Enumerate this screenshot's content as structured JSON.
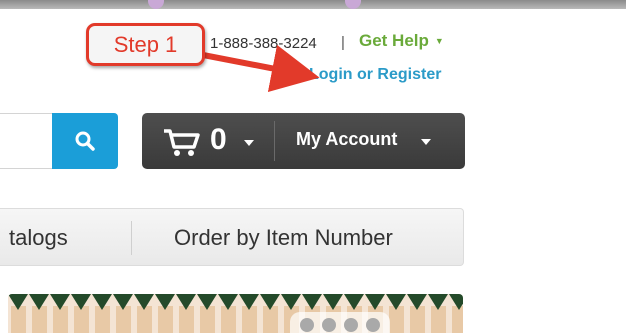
{
  "header": {
    "phone": "1-888-388-3224",
    "separator": "|",
    "get_help": "Get Help",
    "login_register": "Login or Register"
  },
  "annotation": {
    "step_label": "Step 1",
    "color": "#e23a2a"
  },
  "search": {
    "button_icon": "search-icon",
    "color": "#1b9ed8"
  },
  "cart": {
    "count": "0",
    "icon": "cart-icon",
    "account_label": "My Account"
  },
  "nav": {
    "items": [
      "talogs",
      "Order by Item Number"
    ]
  },
  "colors": {
    "help_green": "#6aaa3a",
    "link_blue": "#2b9bc8",
    "bar_dark": "#444444"
  }
}
